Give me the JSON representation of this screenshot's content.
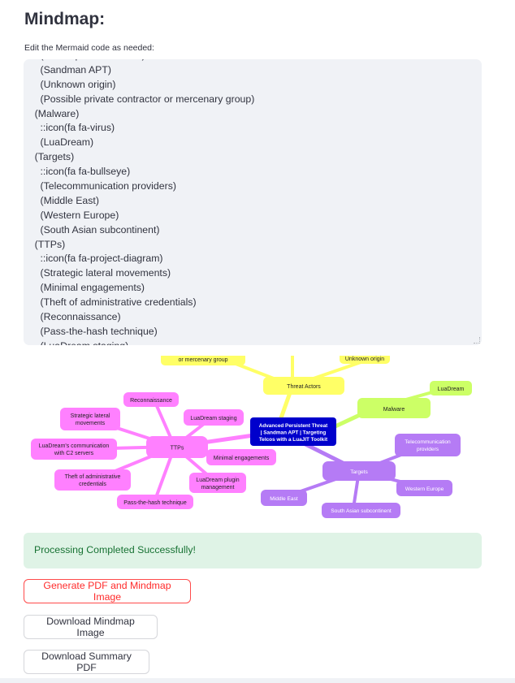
{
  "page": {
    "title": "Mindmap:",
    "editor_label": "Edit the Mermaid code as needed:"
  },
  "code_lines": [
    "      (State-sponsored actor)",
    "      (Sandman APT)",
    "      (Unknown origin)",
    "      (Possible private contractor or mercenary group)",
    "    (Malware)",
    "      ::icon(fa fa-virus)",
    "      (LuaDream)",
    "    (Targets)",
    "      ::icon(fa fa-bullseye)",
    "      (Telecommunication providers)",
    "      (Middle East)",
    "      (Western Europe)",
    "      (South Asian subcontinent)",
    "    (TTPs)",
    "      ::icon(fa fa-project-diagram)",
    "      (Strategic lateral movements)",
    "      (Minimal engagements)",
    "      (Theft of administrative credentials)",
    "      (Reconnaissance)",
    "      (Pass-the-hash technique)",
    "      (LuaDream staging)"
  ],
  "mindmap": {
    "root": "Advanced Persistent Threat | Sandman APT | Targeting Telcos with a LuaJIT Toolkit",
    "root_lines": [
      "Advanced Persistent Threat",
      "| Sandman APT | Targeting",
      "Telcos with a LuaJIT Toolkit"
    ],
    "threat_actors": {
      "label": "Threat Actors",
      "children": [
        "or mercenary group",
        "Unknown origin"
      ]
    },
    "malware": {
      "label": "Malware",
      "children": [
        "LuaDream"
      ]
    },
    "targets": {
      "label": "Targets",
      "children": [
        "Telecommunication providers",
        "Western Europe",
        "South Asian subcontinent",
        "Middle East"
      ],
      "telecom_lines": [
        "Telecommunication",
        "providers"
      ]
    },
    "ttps": {
      "label": "TTPs",
      "children": [
        "Reconnaissance",
        "LuaDream staging",
        "Minimal engagements",
        "LuaDream plugin management",
        "Pass-the-hash technique",
        "Theft of administrative credentials",
        "LuaDream's communication with C2 servers",
        "Strategic lateral movements"
      ],
      "lateral_lines": [
        "Strategic lateral",
        "movements"
      ],
      "c2_lines": [
        "LuaDream's communication",
        "with C2 servers"
      ],
      "theft_lines": [
        "Theft of administrative",
        "credentials"
      ],
      "plugin_lines": [
        "LuaDream plugin",
        "management"
      ]
    },
    "colors": {
      "root": "#0000cc",
      "threat_actors": "#ffff66",
      "malware": "#ccff66",
      "targets": "#b57bf5",
      "ttps": "#ff80ff"
    }
  },
  "status": {
    "success_message": "Processing Completed Successfully!"
  },
  "buttons": {
    "generate": "Generate PDF and Mindmap Image",
    "download_image": "Download Mindmap Image",
    "download_pdf": "Download Summary PDF"
  }
}
